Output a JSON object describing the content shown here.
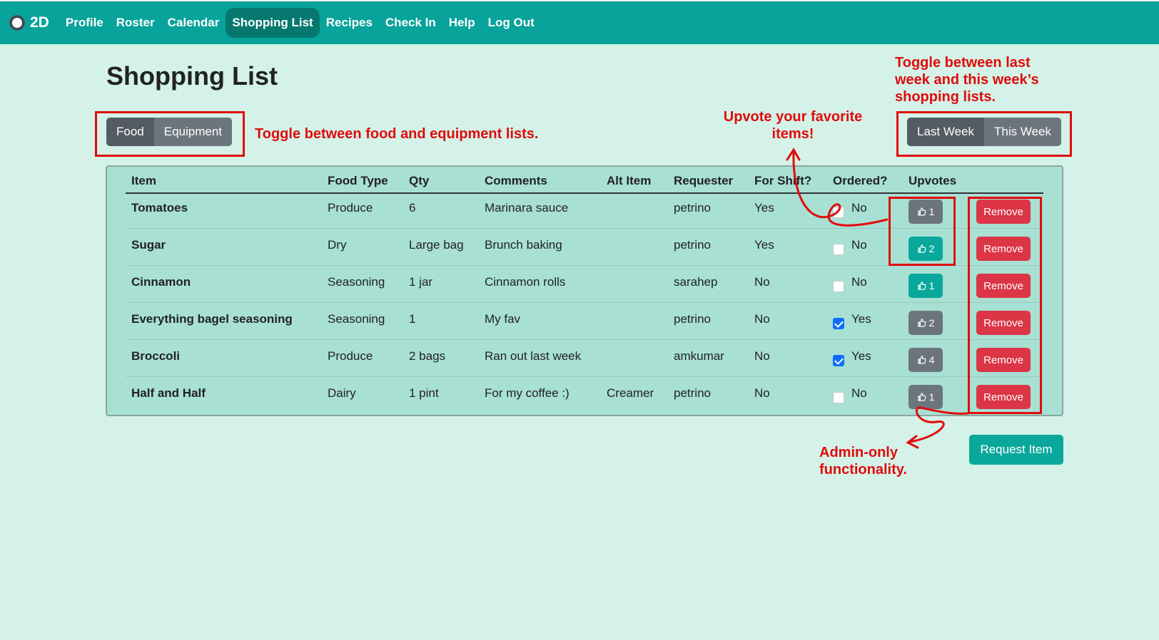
{
  "nav": {
    "brand": "2D",
    "items": [
      "Profile",
      "Roster",
      "Calendar",
      "Shopping List",
      "Recipes",
      "Check In",
      "Help",
      "Log Out"
    ],
    "active": "Shopping List"
  },
  "page": {
    "title": "Shopping List"
  },
  "list_toggle": {
    "food": "Food",
    "equipment": "Equipment",
    "active": "Food"
  },
  "week_toggle": {
    "last": "Last Week",
    "this": "This Week",
    "active": "Last Week"
  },
  "table": {
    "headers": [
      "Item",
      "Food Type",
      "Qty",
      "Comments",
      "Alt Item",
      "Requester",
      "For Shift?",
      "Ordered?",
      "Upvotes"
    ],
    "rows": [
      {
        "item": "Tomatoes",
        "food_type": "Produce",
        "qty": "6",
        "comments": "Marinara sauce",
        "alt_item": "",
        "requester": "petrino",
        "for_shift": "Yes",
        "ordered": false,
        "ordered_label": "No",
        "upvotes": "1",
        "voted": false
      },
      {
        "item": "Sugar",
        "food_type": "Dry",
        "qty": "Large bag",
        "comments": "Brunch baking",
        "alt_item": "",
        "requester": "petrino",
        "for_shift": "Yes",
        "ordered": false,
        "ordered_label": "No",
        "upvotes": "2",
        "voted": true
      },
      {
        "item": "Cinnamon",
        "food_type": "Seasoning",
        "qty": "1 jar",
        "comments": "Cinnamon rolls",
        "alt_item": "",
        "requester": "sarahep",
        "for_shift": "No",
        "ordered": false,
        "ordered_label": "No",
        "upvotes": "1",
        "voted": true
      },
      {
        "item": "Everything bagel seasoning",
        "food_type": "Seasoning",
        "qty": "1",
        "comments": "My fav",
        "alt_item": "",
        "requester": "petrino",
        "for_shift": "No",
        "ordered": true,
        "ordered_label": "Yes",
        "upvotes": "2",
        "voted": false
      },
      {
        "item": "Broccoli",
        "food_type": "Produce",
        "qty": "2 bags",
        "comments": "Ran out last week",
        "alt_item": "",
        "requester": "amkumar",
        "for_shift": "No",
        "ordered": true,
        "ordered_label": "Yes",
        "upvotes": "4",
        "voted": false
      },
      {
        "item": "Half and Half",
        "food_type": "Dairy",
        "qty": "1 pint",
        "comments": "For my coffee :)",
        "alt_item": "Creamer",
        "requester": "petrino",
        "for_shift": "No",
        "ordered": false,
        "ordered_label": "No",
        "upvotes": "1",
        "voted": false
      }
    ],
    "remove_label": "Remove"
  },
  "request_button": "Request Item",
  "annotations": {
    "toggle_lists": "Toggle between food and equipment lists.",
    "upvote_line1": "Upvote your favorite",
    "upvote_line2": "items!",
    "toggle_weeks_line1": "Toggle between last",
    "toggle_weeks_line2": "week and this week’s",
    "toggle_weeks_line3": "shopping lists.",
    "admin_line1": "Admin-only",
    "admin_line2": "functionality."
  },
  "colors": {
    "navbar": "#08a39a",
    "background": "#d4f2e8",
    "table_bg": "#a8e0d4",
    "annotation": "#e10b0b",
    "remove": "#dc3545",
    "upvoted": "#0aa89c",
    "neutral_button": "#6c757d"
  },
  "icons": {
    "upvote": "thumbs-up-icon",
    "brand": "logo-icon"
  }
}
